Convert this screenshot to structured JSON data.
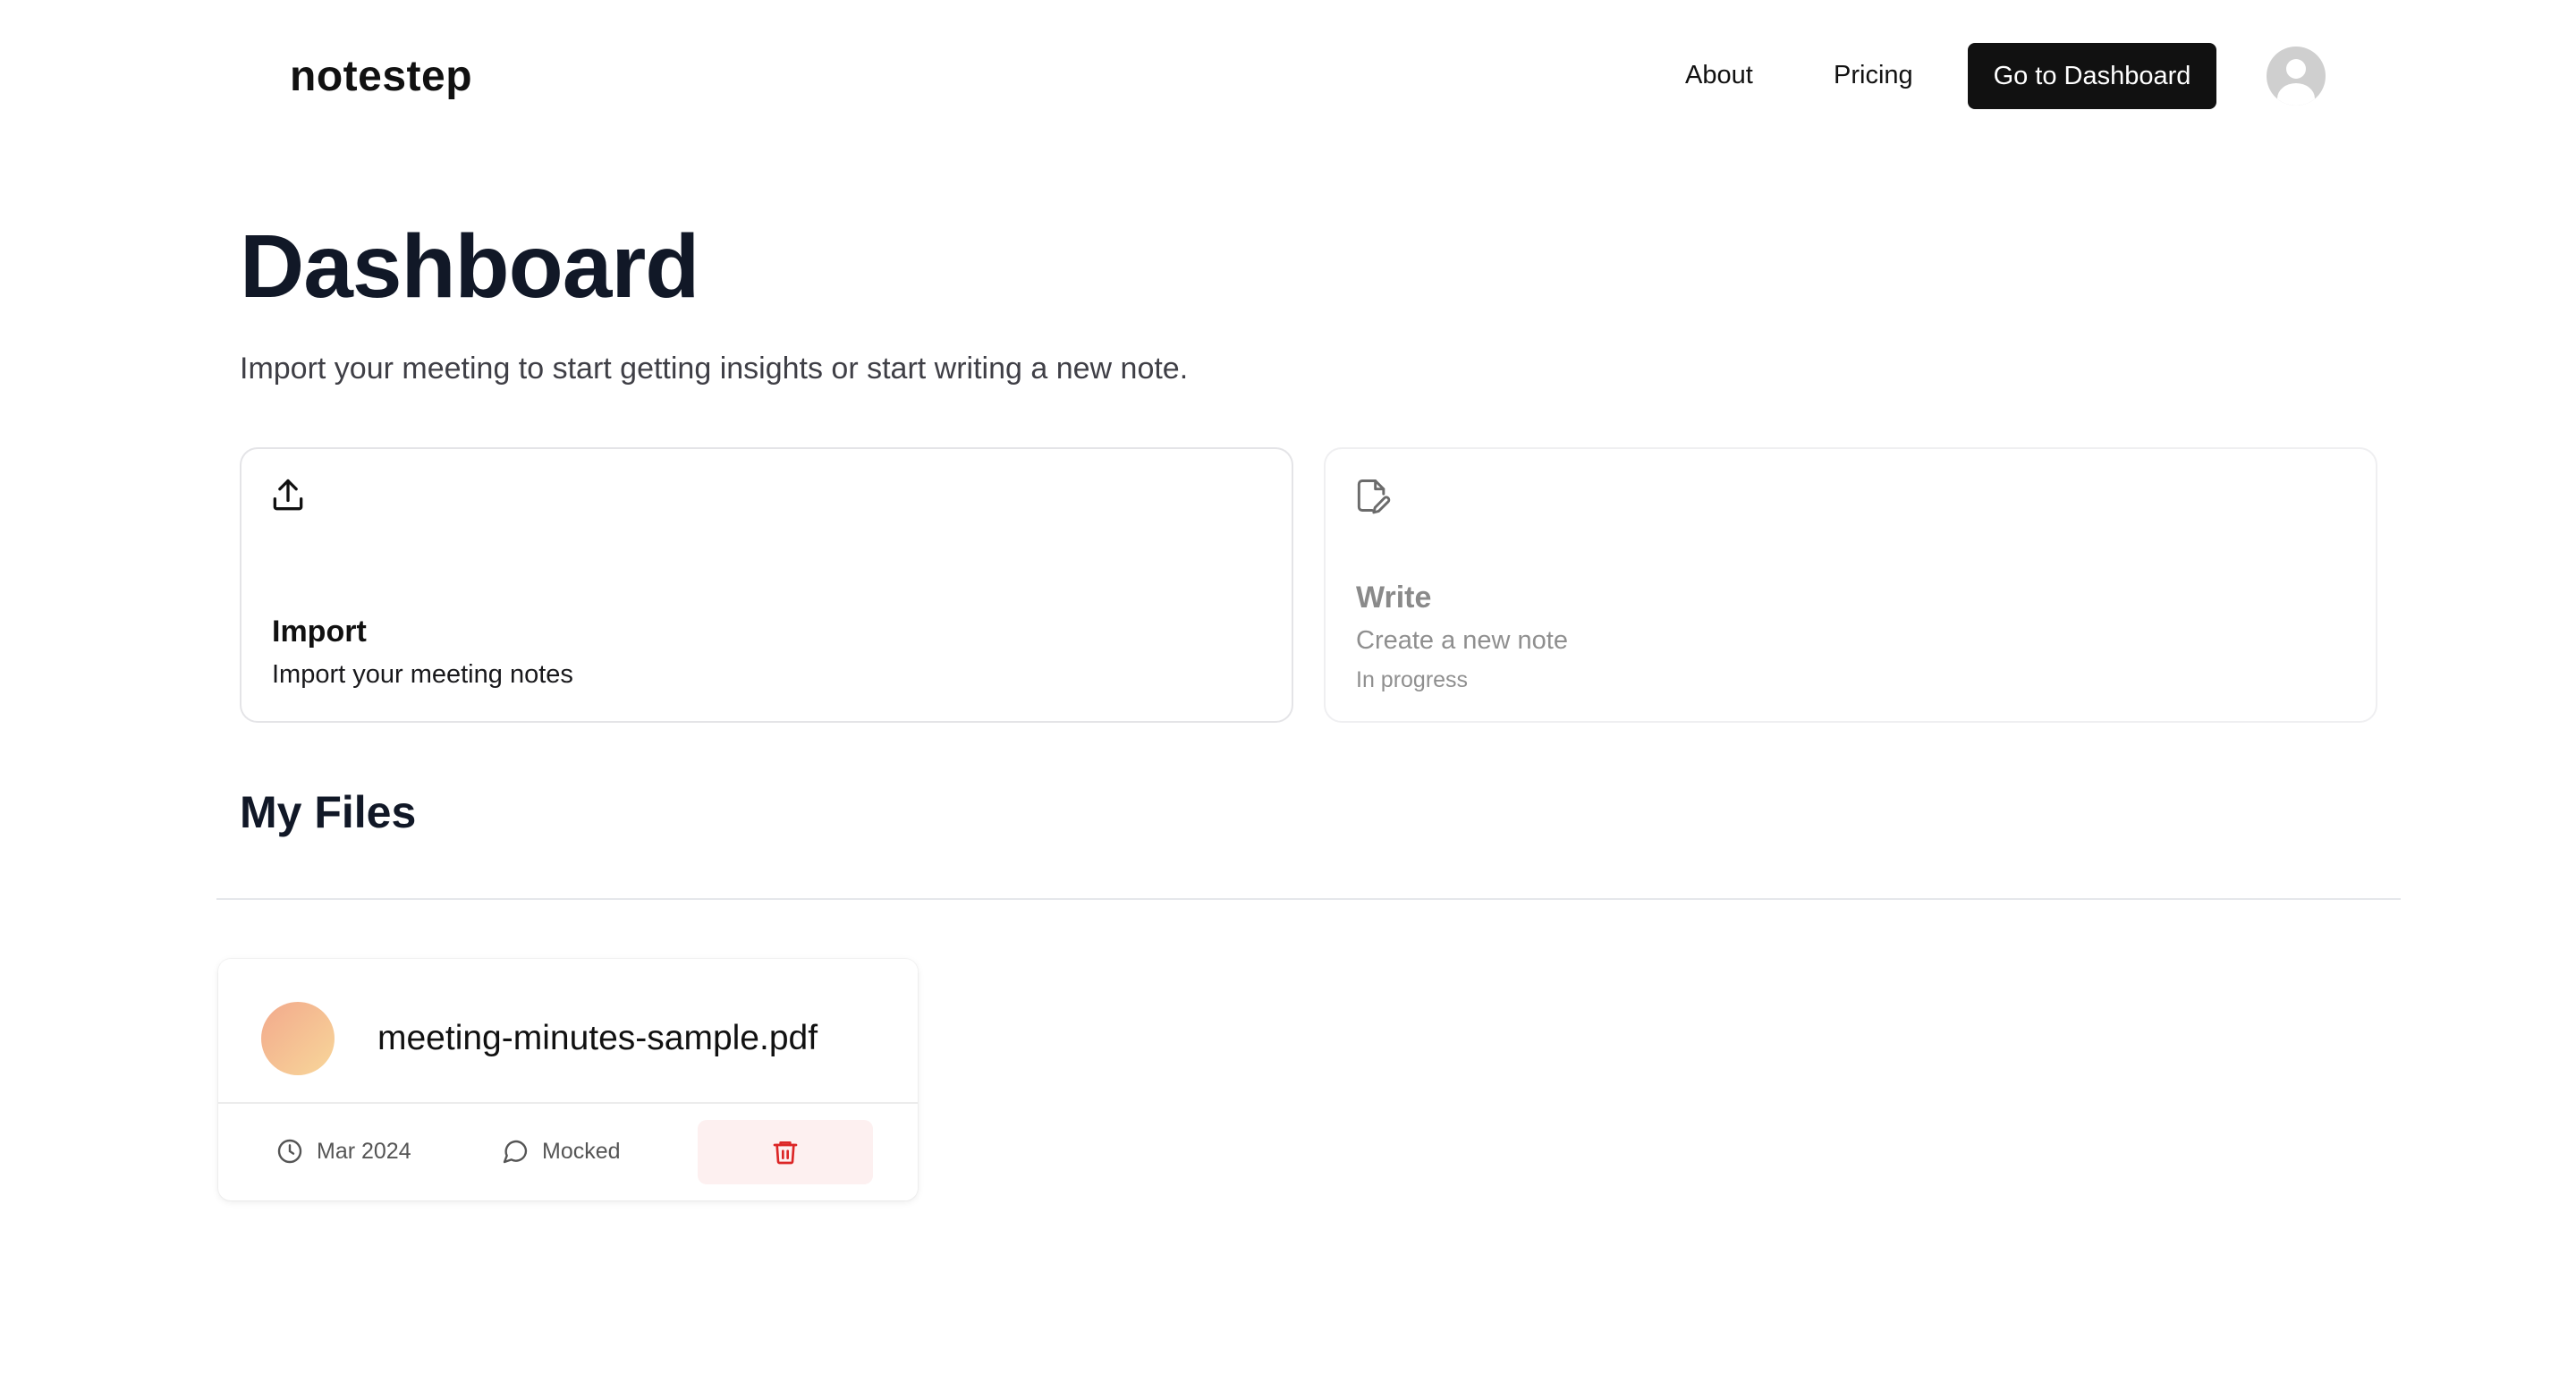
{
  "header": {
    "logo": "notestep",
    "nav": {
      "about": "About",
      "pricing": "Pricing"
    },
    "cta": "Go to Dashboard",
    "avatar_icon": "user-avatar-icon"
  },
  "main": {
    "title": "Dashboard",
    "subtitle": "Import your meeting to start getting insights or start writing a new note.",
    "cards": {
      "import": {
        "icon": "upload-icon",
        "title": "Import",
        "description": "Import your meeting notes"
      },
      "write": {
        "icon": "file-edit-icon",
        "title": "Write",
        "description": "Create a new note",
        "status": "In progress"
      }
    },
    "files_section": {
      "title": "My Files",
      "files": [
        {
          "name": "meeting-minutes-sample.pdf",
          "date": "Mar 2024",
          "status": "Mocked",
          "delete_icon": "trash-icon"
        }
      ]
    }
  },
  "colors": {
    "primary": "#111111",
    "text": "#111827",
    "muted": "#8f8f8f",
    "danger": "#dc2626",
    "danger_bg": "#fdf0f0",
    "thumb_gradient_start": "#f2a98c",
    "thumb_gradient_end": "#f8d79a"
  }
}
